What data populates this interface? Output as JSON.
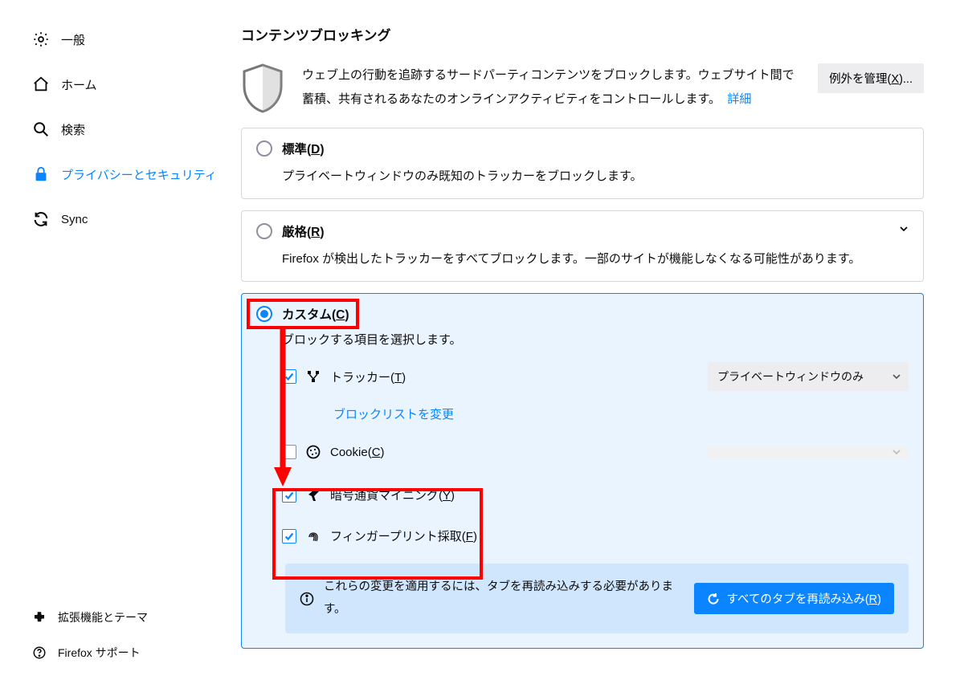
{
  "sidebar": {
    "items": [
      {
        "label": "一般"
      },
      {
        "label": "ホーム"
      },
      {
        "label": "検索"
      },
      {
        "label": "プライバシーとセキュリティ"
      },
      {
        "label": "Sync"
      }
    ],
    "bottom": [
      {
        "label": "拡張機能とテーマ"
      },
      {
        "label": "Firefox サポート"
      }
    ]
  },
  "content": {
    "section_title": "コンテンツブロッキング",
    "intro_text": "ウェブ上の行動を追跡するサードパーティコンテンツをブロックします。ウェブサイト間で蓄積、共有されるあなたのオンラインアクティビティをコントロールします。",
    "details_link": "詳細",
    "manage_exceptions_prefix": "例外を管理(",
    "manage_exceptions_key": "X",
    "manage_exceptions_suffix": ")...",
    "standard": {
      "label_prefix": "標準(",
      "label_key": "D",
      "label_suffix": ")",
      "desc": "プライベートウィンドウのみ既知のトラッカーをブロックします。"
    },
    "strict": {
      "label_prefix": "厳格(",
      "label_key": "R",
      "label_suffix": ")",
      "desc": "Firefox が検出したトラッカーをすべてブロックします。一部のサイトが機能しなくなる可能性があります。"
    },
    "custom": {
      "label_prefix": "カスタム(",
      "label_key": "C",
      "label_suffix": ")",
      "desc": "ブロックする項目を選択します。",
      "trackers_prefix": "トラッカー(",
      "trackers_key": "T",
      "trackers_suffix": ")",
      "trackers_dropdown": "プライベートウィンドウのみ",
      "blocklist_link": "ブロックリストを変更",
      "cookies_prefix": "Cookie(",
      "cookies_key": "C",
      "cookies_suffix": ")",
      "cryptominers_prefix": "暗号通貨マイニング(",
      "cryptominers_key": "Y",
      "cryptominers_suffix": ")",
      "fingerprinters_prefix": "フィンガープリント採取(",
      "fingerprinters_key": "F",
      "fingerprinters_suffix": ")"
    },
    "notice": {
      "text": "これらの変更を適用するには、タブを再読み込みする必要があります。",
      "reload_prefix": "すべてのタブを再読み込み(",
      "reload_key": "R",
      "reload_suffix": ")"
    }
  }
}
